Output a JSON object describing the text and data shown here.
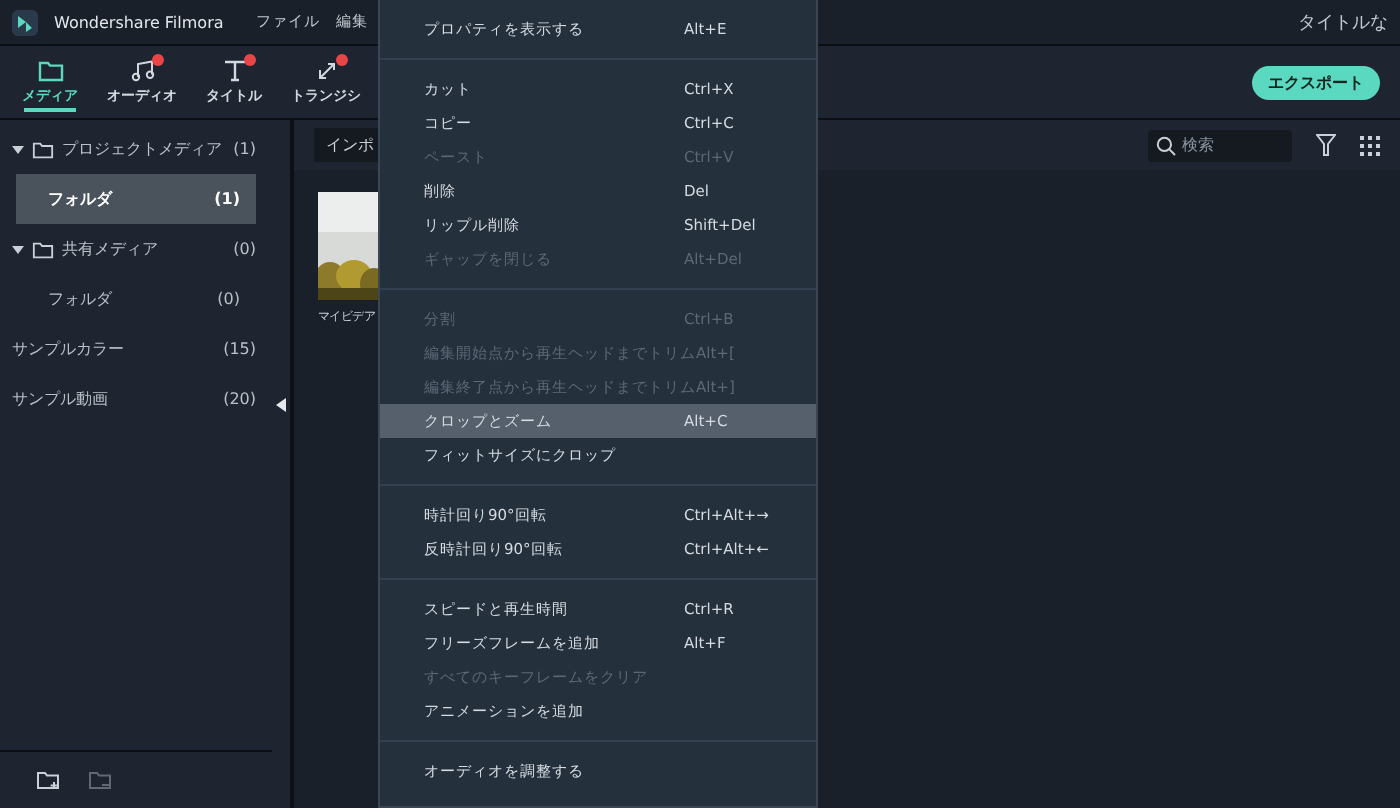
{
  "app": {
    "title": "Wondershare Filmora",
    "menus": [
      "ファイル",
      "編集"
    ],
    "project_title": "タイトルな"
  },
  "tabs": [
    {
      "label": "メディア",
      "selected": true,
      "badge": false
    },
    {
      "label": "オーディオ",
      "selected": false,
      "badge": true
    },
    {
      "label": "タイトル",
      "selected": false,
      "badge": true
    },
    {
      "label": "トランジシ",
      "selected": false,
      "badge": true
    }
  ],
  "export_button": "エクスポート",
  "sidebar": {
    "items": [
      {
        "label": "プロジェクトメディア",
        "count": "(1)",
        "expanded": true,
        "selected": false,
        "children": [
          {
            "label": "フォルダ",
            "count": "(1)",
            "selected": true
          }
        ]
      },
      {
        "label": "共有メディア",
        "count": "(0)",
        "expanded": true,
        "selected": false,
        "children": [
          {
            "label": "フォルダ",
            "count": "(0)",
            "selected": false
          }
        ]
      },
      {
        "label": "サンプルカラー",
        "count": "(15)",
        "selected": false
      },
      {
        "label": "サンプル動画",
        "count": "(20)",
        "selected": false
      }
    ]
  },
  "media": {
    "import_button": "インポ",
    "search": {
      "placeholder": "検索"
    },
    "items": [
      {
        "label": "マイビデア",
        "kind": "picture"
      }
    ]
  },
  "context_menu": {
    "groups": [
      [
        {
          "label": "プロパティを表示する",
          "shortcut": "Alt+E",
          "disabled": false,
          "selected": false
        }
      ],
      [
        {
          "label": "カット",
          "shortcut": "Ctrl+X",
          "disabled": false,
          "selected": false
        },
        {
          "label": "コピー",
          "shortcut": "Ctrl+C",
          "disabled": false,
          "selected": false
        },
        {
          "label": "ペースト",
          "shortcut": "Ctrl+V",
          "disabled": true,
          "selected": false
        },
        {
          "label": "削除",
          "shortcut": "Del",
          "disabled": false,
          "selected": false
        },
        {
          "label": "リップル削除",
          "shortcut": "Shift+Del",
          "disabled": false,
          "selected": false
        },
        {
          "label": "ギャップを閉じる",
          "shortcut": "Alt+Del",
          "disabled": true,
          "selected": false
        }
      ],
      [
        {
          "label": "分割",
          "shortcut": "Ctrl+B",
          "disabled": true,
          "selected": false
        },
        {
          "label": "編集開始点から再生ヘッドまでトリム",
          "shortcut": "Alt+[",
          "disabled": true,
          "selected": false
        },
        {
          "label": "編集終了点から再生ヘッドまでトリム",
          "shortcut": "Alt+]",
          "disabled": true,
          "selected": false
        },
        {
          "label": "クロップとズーム",
          "shortcut": "Alt+C",
          "disabled": false,
          "selected": true
        },
        {
          "label": "フィットサイズにクロップ",
          "disabled": false,
          "selected": false
        }
      ],
      [
        {
          "label": "時計回り90°回転",
          "shortcut": "Ctrl+Alt+→",
          "disabled": false,
          "selected": false
        },
        {
          "label": "反時計回り90°回転",
          "shortcut": "Ctrl+Alt+←",
          "disabled": false,
          "selected": false
        }
      ],
      [
        {
          "label": "スピードと再生時間",
          "shortcut": "Ctrl+R",
          "disabled": false,
          "selected": false
        },
        {
          "label": "フリーズフレームを追加",
          "shortcut": "Alt+F",
          "disabled": false,
          "selected": false
        },
        {
          "label": "すべてのキーフレームをクリア",
          "disabled": true,
          "selected": false
        },
        {
          "label": "アニメーションを追加",
          "disabled": false,
          "selected": false
        }
      ],
      [
        {
          "label": "オーディオを調整する",
          "disabled": false,
          "selected": false
        }
      ]
    ]
  }
}
